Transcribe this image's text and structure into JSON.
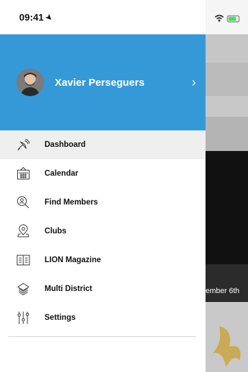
{
  "status_bar": {
    "time": "09:41"
  },
  "profile": {
    "name": "Xavier Perseguers"
  },
  "menu": [
    {
      "label": "Dashboard",
      "icon": "satellite-dish-icon",
      "active": true
    },
    {
      "label": "Calendar",
      "icon": "calendar-icon",
      "active": false
    },
    {
      "label": "Find Members",
      "icon": "search-person-icon",
      "active": false
    },
    {
      "label": "Clubs",
      "icon": "location-pin-icon",
      "active": false
    },
    {
      "label": "LION Magazine",
      "icon": "magazine-icon",
      "active": false
    },
    {
      "label": "Multi District",
      "icon": "layers-icon",
      "active": false
    },
    {
      "label": "Settings",
      "icon": "sliders-icon",
      "active": false
    }
  ],
  "background": {
    "caption": "ember 6th"
  },
  "colors": {
    "header": "#3699d7",
    "active_row": "#efefef"
  }
}
